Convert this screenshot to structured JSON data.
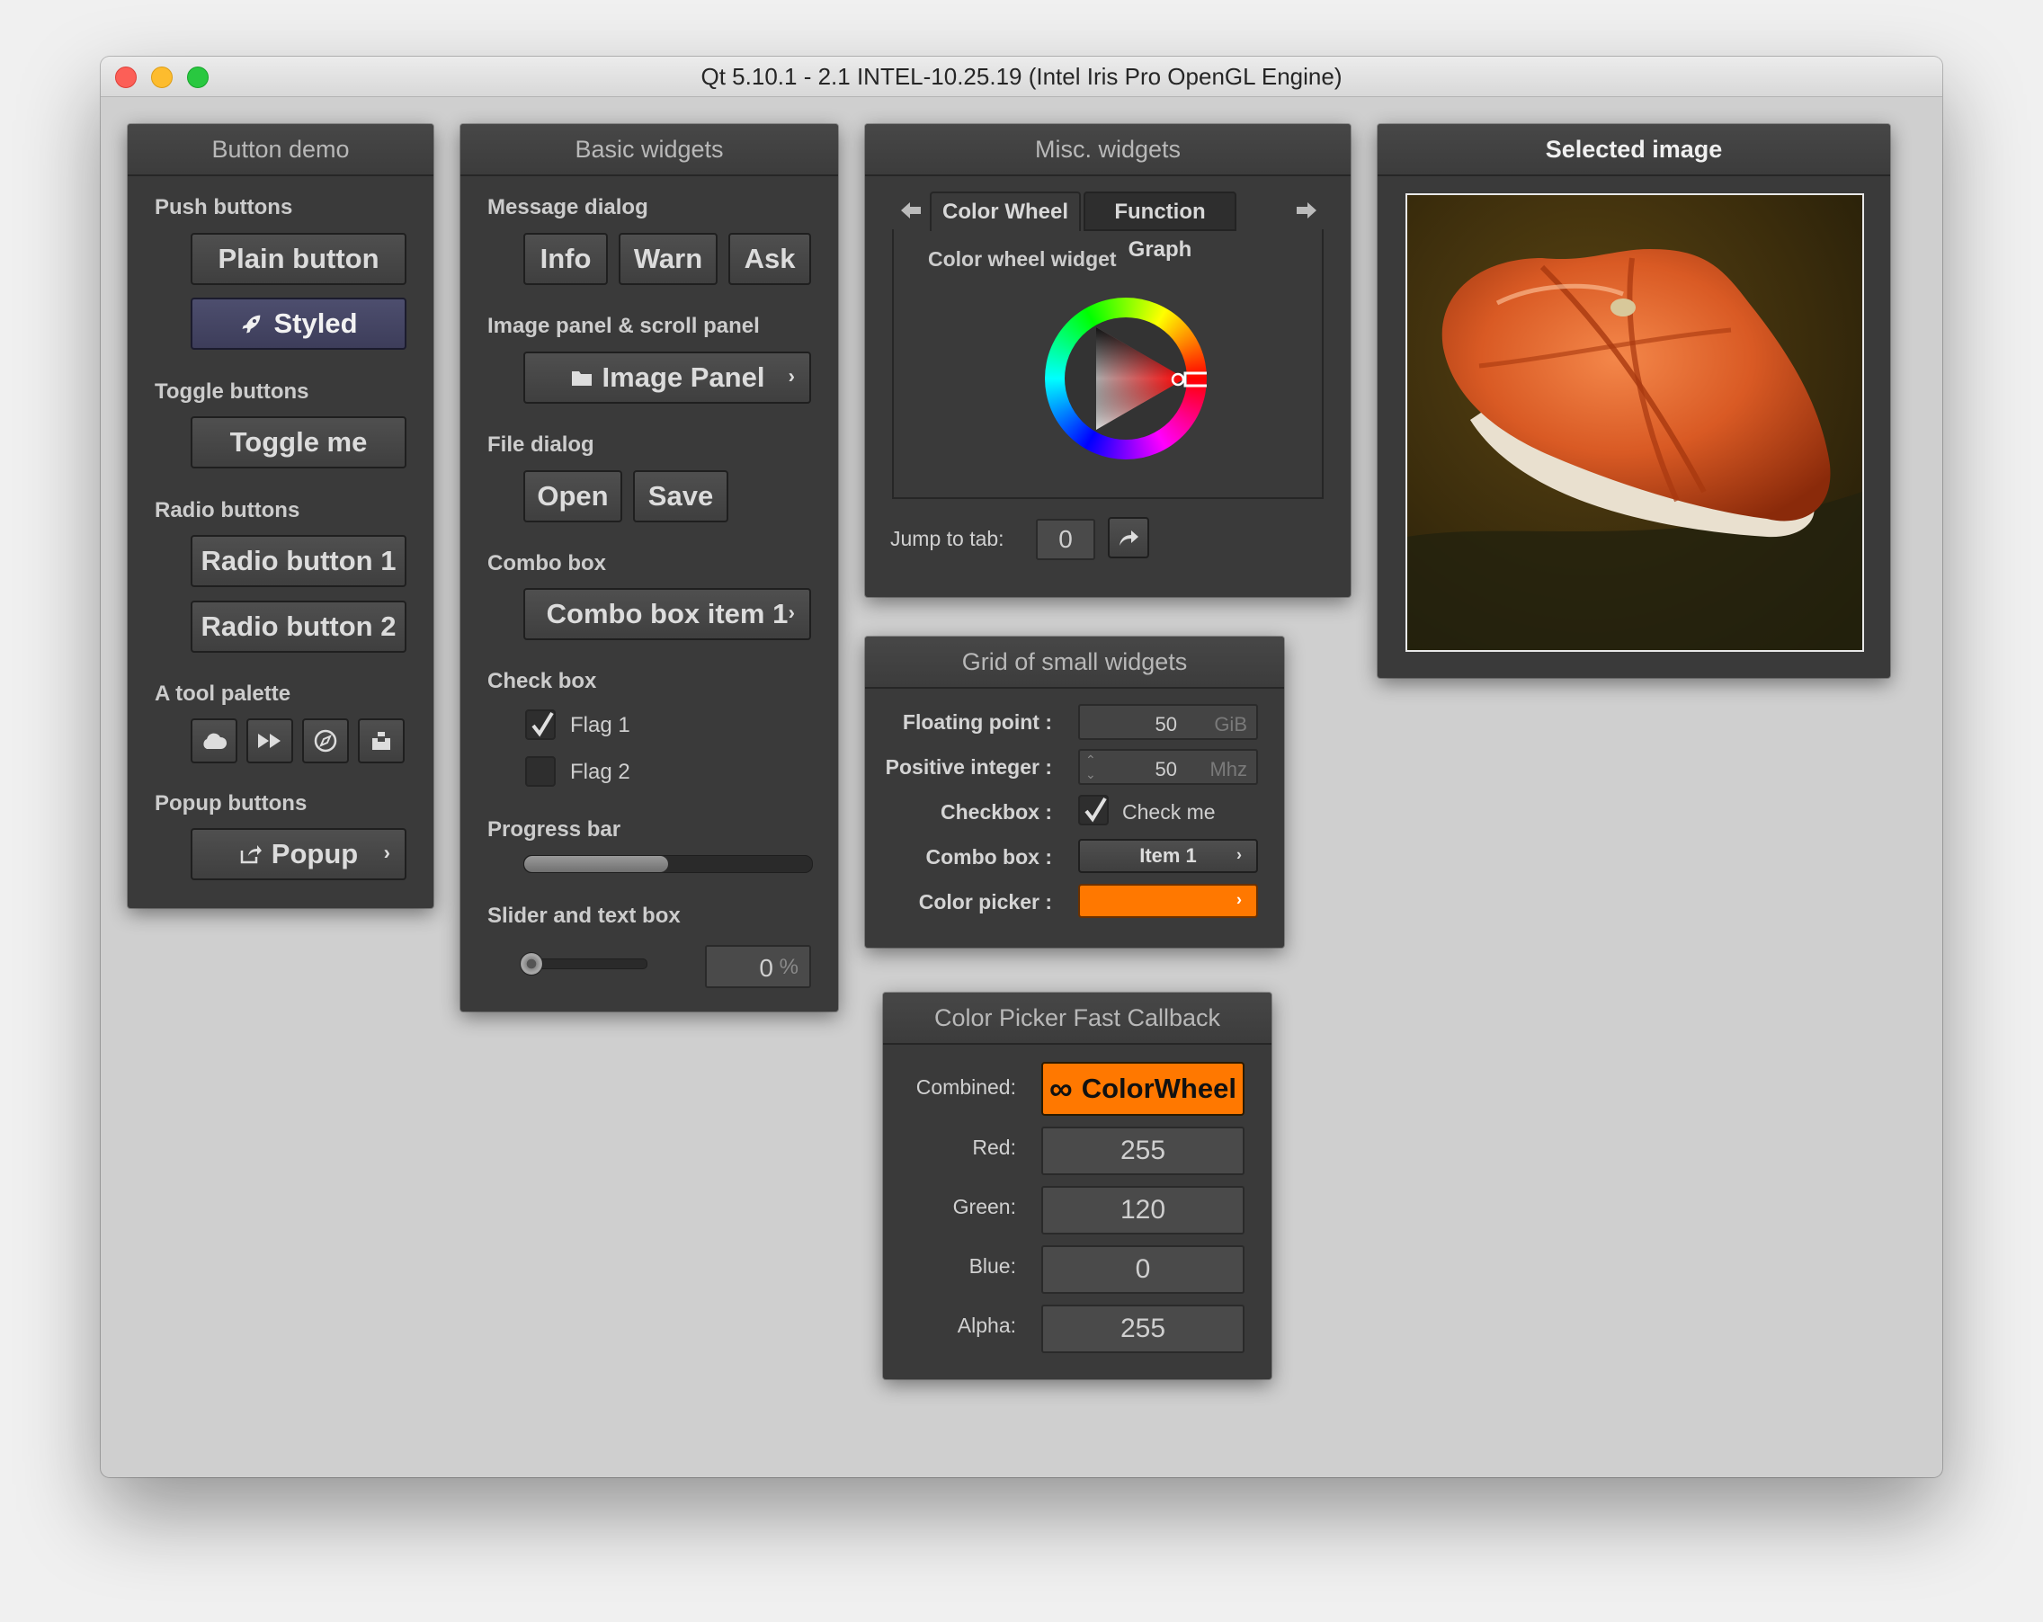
{
  "window": {
    "title": "Qt 5.10.1 - 2.1 INTEL-10.25.19 (Intel Iris Pro OpenGL Engine)"
  },
  "button_demo": {
    "title": "Button demo",
    "push_label": "Push buttons",
    "plain": "Plain button",
    "styled": "Styled",
    "toggle_label": "Toggle buttons",
    "toggle": "Toggle me",
    "radio_label": "Radio buttons",
    "radio1": "Radio button 1",
    "radio2": "Radio button 2",
    "tool_label": "A tool palette",
    "tools": [
      "cloud-icon",
      "fast-forward-icon",
      "compass-icon",
      "inbox-icon"
    ],
    "popup_label": "Popup buttons",
    "popup": "Popup"
  },
  "basic_widgets": {
    "title": "Basic widgets",
    "message_label": "Message dialog",
    "info": "Info",
    "warn": "Warn",
    "ask": "Ask",
    "image_label": "Image panel & scroll panel",
    "image_panel": "Image Panel",
    "file_label": "File dialog",
    "open": "Open",
    "save": "Save",
    "combo_label": "Combo box",
    "combo_value": "Combo box item 1",
    "check_label": "Check box",
    "flag1": "Flag 1",
    "flag1_checked": true,
    "flag2": "Flag 2",
    "flag2_checked": false,
    "progress_label": "Progress bar",
    "progress_value": 0.5,
    "slider_label": "Slider and text box",
    "slider_value": "0",
    "slider_unit": "%"
  },
  "misc_widgets": {
    "title": "Misc. widgets",
    "tabs": [
      "Color Wheel",
      "Function Graph"
    ],
    "active_tab": 0,
    "wheel_label": "Color wheel widget",
    "jump_label": "Jump to tab:",
    "jump_value": "0"
  },
  "selected_image": {
    "title": "Selected image"
  },
  "grid": {
    "title": "Grid of small widgets",
    "float_label": "Floating point :",
    "float_value": "50",
    "float_unit": "GiB",
    "int_label": "Positive integer :",
    "int_value": "50",
    "int_unit": "Mhz",
    "check_label": "Checkbox :",
    "check_text": "Check me",
    "combo_label": "Combo box :",
    "combo_value": "Item 1",
    "color_label": "Color picker :",
    "color": "#ff7800"
  },
  "picker": {
    "title": "Color Picker Fast Callback",
    "combined_label": "Combined:",
    "combined_value": "ColorWheel",
    "red_label": "Red:",
    "red": "255",
    "green_label": "Green:",
    "green": "120",
    "blue_label": "Blue:",
    "blue": "0",
    "alpha_label": "Alpha:",
    "alpha": "255"
  },
  "colors": {
    "panel": "#3a3a3a",
    "styled_button": "#44455f",
    "accent_orange": "#ff7800",
    "window_bg": "#cfcfcf"
  }
}
